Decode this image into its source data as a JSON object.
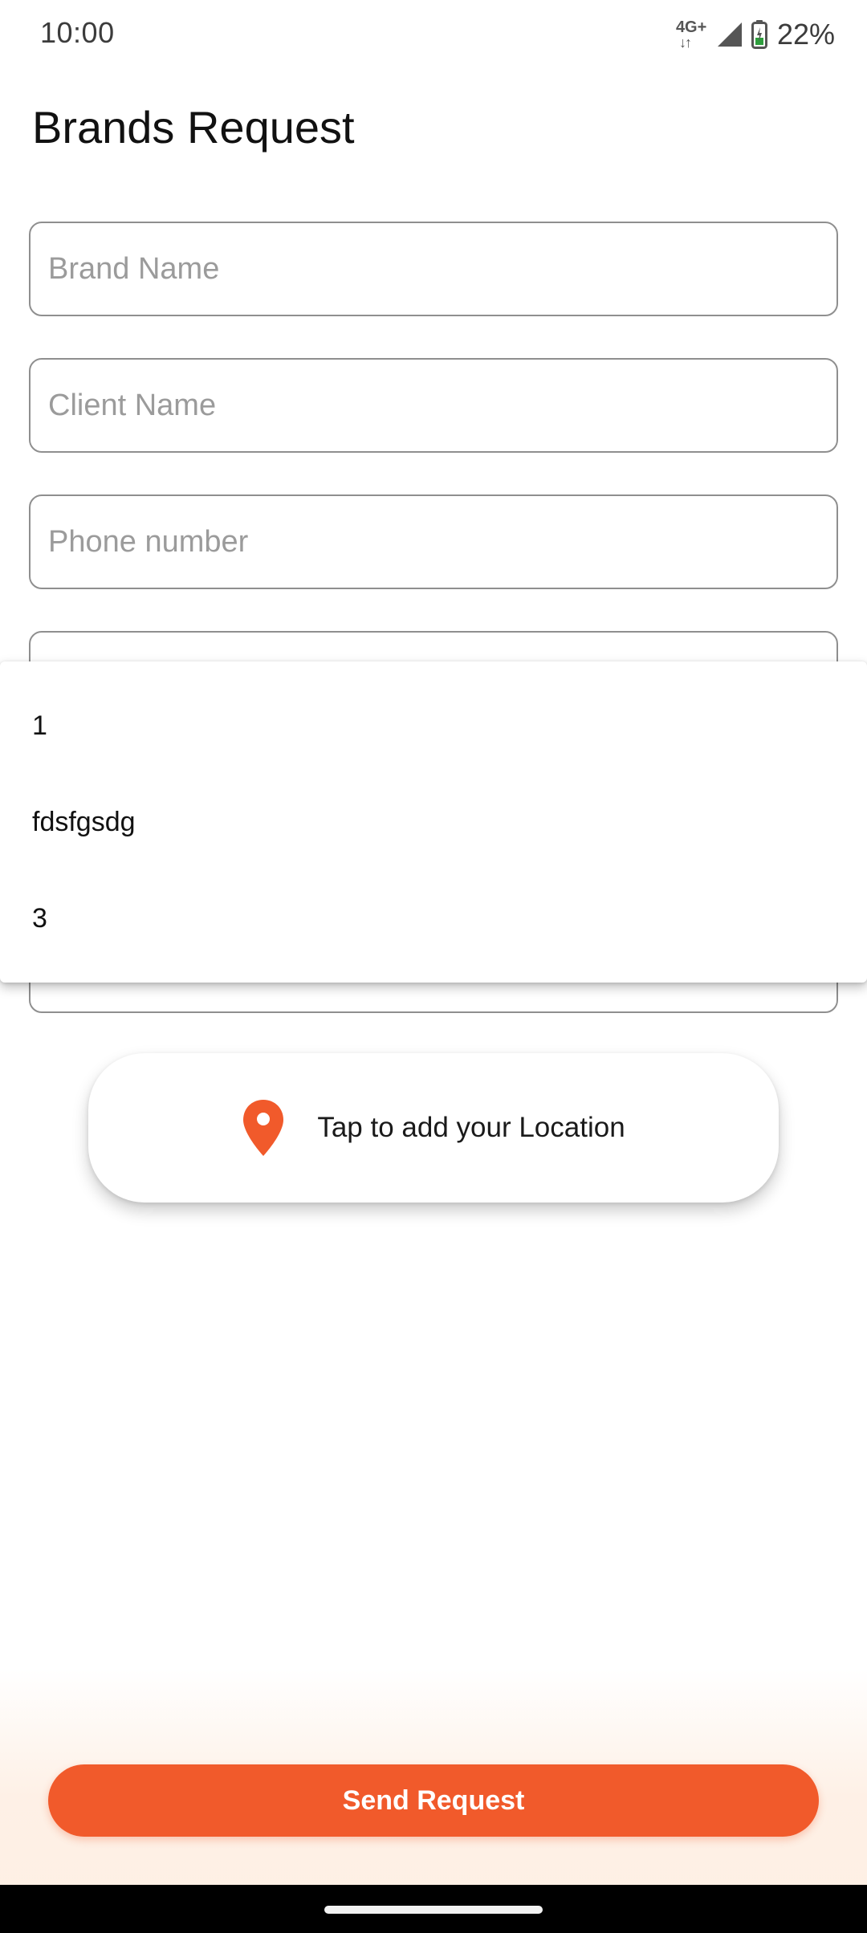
{
  "status_bar": {
    "time": "10:00",
    "network": "4G+",
    "battery_percent": "22%",
    "icons": [
      "network-4g-icon",
      "signal-icon",
      "battery-icon"
    ]
  },
  "page": {
    "title": "Brands Request"
  },
  "form": {
    "brand_name_placeholder": "Brand Name",
    "client_name_placeholder": "Client Name",
    "phone_placeholder": "Phone number"
  },
  "dropdown": {
    "options": [
      {
        "label": "1"
      },
      {
        "label": "fdsfgsdg"
      },
      {
        "label": "3"
      }
    ]
  },
  "location": {
    "label": "Tap to add your Location",
    "icon": "location-pin-icon"
  },
  "actions": {
    "send_label": "Send Request"
  },
  "colors": {
    "accent": "#f15a2b",
    "field_border": "#8f8f8f",
    "placeholder": "#9b9b9b"
  }
}
